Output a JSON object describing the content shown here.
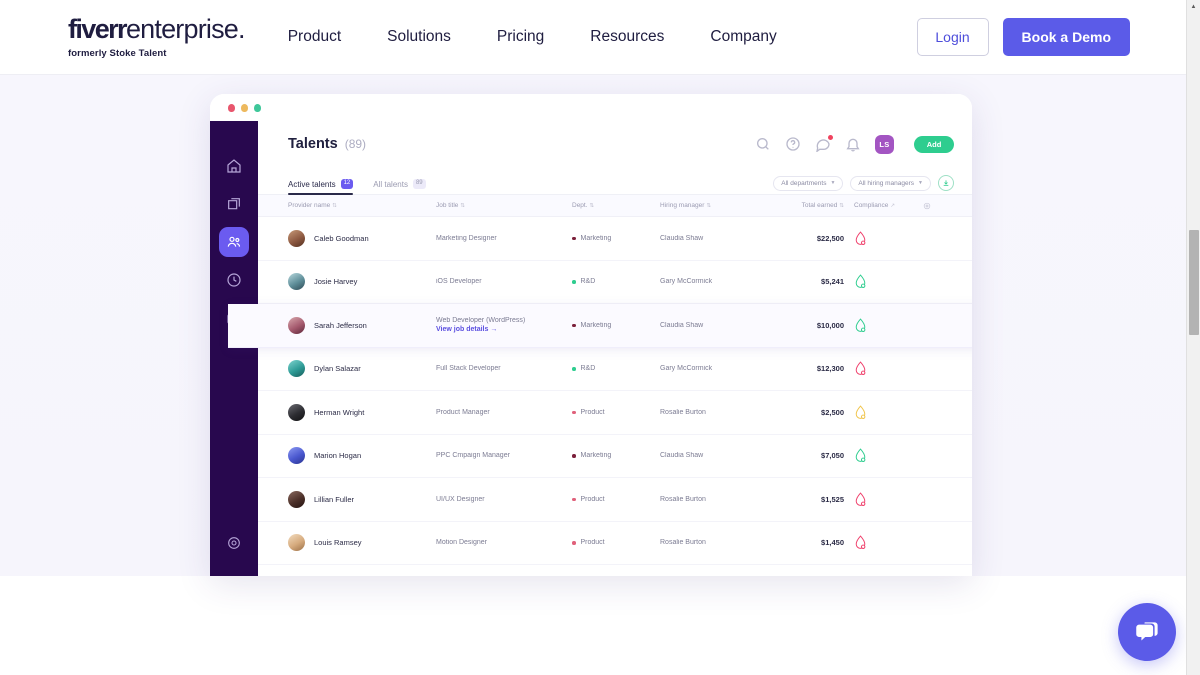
{
  "topnav": {
    "brand": {
      "word1": "fiverr",
      "word2": "enterprise.",
      "tagline": "formerly Stoke Talent"
    },
    "links": [
      "Product",
      "Solutions",
      "Pricing",
      "Resources",
      "Company"
    ],
    "login_label": "Login",
    "demo_label": "Book a Demo",
    "accent_color": "#5b5be8"
  },
  "app": {
    "titlebar_dots": [
      "#e8566d",
      "#edb95e",
      "#3ec79a"
    ],
    "sidebar": {
      "items": [
        {
          "name": "home-icon",
          "active": false
        },
        {
          "name": "package-icon",
          "active": false
        },
        {
          "name": "people-icon",
          "active": true
        },
        {
          "name": "clock-icon",
          "active": false
        },
        {
          "name": "briefcase-icon",
          "active": false
        }
      ],
      "bottom": {
        "name": "settings-gear-icon"
      },
      "bg_color": "#28084e",
      "active_color": "#6b5bf0"
    },
    "header": {
      "title": "Talents",
      "count": "(89)",
      "icons": [
        "search-icon",
        "help-circle-icon",
        "message-icon",
        "bell-icon"
      ],
      "message_has_badge": true,
      "avatar_initials": "LS",
      "avatar_color": "#a355c2",
      "add_label": "Add",
      "add_color": "#2ecd8f"
    },
    "tabs": [
      {
        "label": "Active talents",
        "badge": "12",
        "active": true
      },
      {
        "label": "All talents",
        "badge": "89",
        "active": false
      }
    ],
    "filters": [
      {
        "label": "All departments",
        "name": "departments-filter"
      },
      {
        "label": "All hiring managers",
        "name": "hiring-managers-filter"
      }
    ],
    "export_button": "download-export-icon",
    "table": {
      "columns": [
        {
          "label": "Provider name",
          "sortable": true
        },
        {
          "label": "Job title",
          "sortable": true
        },
        {
          "label": "Dept.",
          "sortable": true
        },
        {
          "label": "Hiring manager",
          "sortable": true
        },
        {
          "label": "Total earned",
          "sortable": true
        },
        {
          "label": "Compliance",
          "external": true
        }
      ],
      "settings_icon": "column-settings-icon",
      "rows": [
        {
          "name": "Caleb Goodman",
          "avatar": "ph1",
          "job_title": "Marketing Designer",
          "job_link": "",
          "dept": "Marketing",
          "dept_color": "#7b1f3a",
          "manager": "Claudia Shaw",
          "earned": "$22,500",
          "compliance": "red",
          "highlight": false
        },
        {
          "name": "Josie Harvey",
          "avatar": "ph2",
          "job_title": "iOS Developer",
          "job_link": "",
          "dept": "R&D",
          "dept_color": "#2ecd8f",
          "manager": "Gary McCormick",
          "earned": "$5,241",
          "compliance": "green",
          "highlight": false
        },
        {
          "name": "Sarah Jefferson",
          "avatar": "ph3",
          "job_title": "Web Developer (WordPress)",
          "job_link": "View job details  →",
          "dept": "Marketing",
          "dept_color": "#7b1f3a",
          "manager": "Claudia Shaw",
          "earned": "$10,000",
          "compliance": "green",
          "highlight": true
        },
        {
          "name": "Dylan Salazar",
          "avatar": "ph4",
          "job_title": "Full Stack Developer",
          "job_link": "",
          "dept": "R&D",
          "dept_color": "#2ecd8f",
          "manager": "Gary McCormick",
          "earned": "$12,300",
          "compliance": "red",
          "highlight": false
        },
        {
          "name": "Herman Wright",
          "avatar": "ph5",
          "job_title": "Product Manager",
          "job_link": "",
          "dept": "Product",
          "dept_color": "#e0607a",
          "manager": "Rosalie Burton",
          "earned": "$2,500",
          "compliance": "yellow",
          "highlight": false
        },
        {
          "name": "Marion Hogan",
          "avatar": "ph6",
          "job_title": "PPC Cmpaign Manager",
          "job_link": "",
          "dept": "Marketing",
          "dept_color": "#7b1f3a",
          "manager": "Claudia Shaw",
          "earned": "$7,050",
          "compliance": "green",
          "highlight": false
        },
        {
          "name": "Lillian Fuller",
          "avatar": "ph7",
          "job_title": "UI/UX Designer",
          "job_link": "",
          "dept": "Product",
          "dept_color": "#e0607a",
          "manager": "Rosalie Burton",
          "earned": "$1,525",
          "compliance": "red",
          "highlight": false
        },
        {
          "name": "Louis Ramsey",
          "avatar": "ph8",
          "job_title": "Motion Designer",
          "job_link": "",
          "dept": "Product",
          "dept_color": "#e0607a",
          "manager": "Rosalie Burton",
          "earned": "$1,450",
          "compliance": "red",
          "highlight": false
        }
      ]
    }
  },
  "chat_widget": {
    "name": "chat-bubble-icon",
    "color": "#5b5be8"
  },
  "scrollbar": {
    "up_arrow": "▲"
  }
}
